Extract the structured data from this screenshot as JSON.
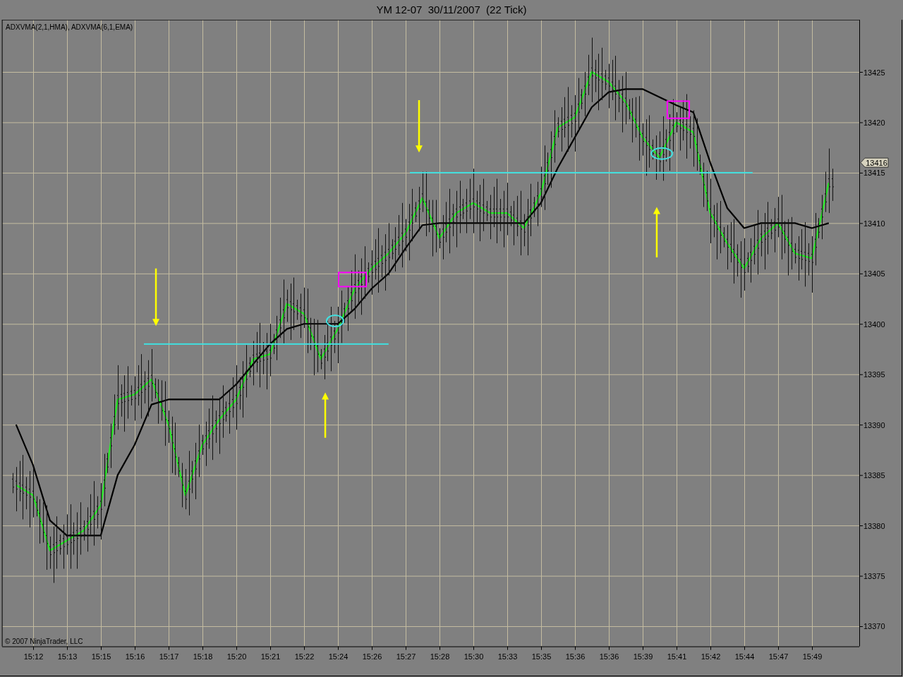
{
  "window": {
    "title": "YM 12-07  30/11/2007  (22 Tick)"
  },
  "chart": {
    "indicator_label": "ADXVMA(2,1,HMA), ADXVMA(6,1,EMA)",
    "copyright": "© 2007 NinjaTrader, LLC",
    "last_price_tag": "13416",
    "chart_data": {
      "type": "line",
      "categories": [
        null,
        "15:12",
        null,
        "15:13",
        null,
        "15:15",
        null,
        "15:16",
        null,
        "15:17",
        null,
        "15:18",
        null,
        "15:20",
        null,
        "15:21",
        null,
        "15:22",
        null,
        "15:24",
        null,
        "15:26",
        null,
        "15:27",
        null,
        "15:28",
        null,
        "15:30",
        null,
        "15:33",
        null,
        "15:35",
        null,
        "15:36",
        null,
        "15:36",
        null,
        "15:39",
        null,
        "15:41",
        null,
        "15:42",
        null,
        "15:44",
        null,
        "15:47",
        null,
        "15:49",
        null
      ],
      "series": [
        {
          "color": "#22e622",
          "values": [
            13384,
            13383,
            13377.5,
            13378.5,
            13379.5,
            13382,
            13392.5,
            13393,
            13394.5,
            13390,
            13383,
            13388,
            13390.5,
            13392.5,
            13396.5,
            13397,
            13402,
            13401,
            13396.5,
            13399.5,
            13403.5,
            13405.5,
            13407,
            13409,
            13412.5,
            13408.5,
            13411,
            13412,
            13411,
            13411,
            13409.5,
            13413,
            13419.5,
            13420.5,
            13425,
            13424,
            13422,
            13418.5,
            13416.5,
            13420,
            13419,
            13411,
            13408,
            13405.5,
            13408.5,
            13410,
            13407,
            13406.5,
            13414
          ]
        },
        {
          "color": "#000000",
          "values": [
            13390,
            13386,
            13380.5,
            13379,
            13379,
            13379,
            13385,
            13388,
            13392,
            13392.5,
            13392.5,
            13392.5,
            13392.5,
            13394,
            13396,
            13398,
            13399.5,
            13400,
            13400,
            13400,
            13401.5,
            13403.5,
            13405,
            13407.5,
            13409.8,
            13410,
            13410,
            13410,
            13410,
            13410,
            13410,
            13412,
            13415.5,
            13418.5,
            13421.5,
            13423,
            13423.3,
            13423.3,
            13422.5,
            13421.7,
            13421,
            13416,
            13411.5,
            13409.5,
            13410,
            13410,
            13410,
            13409.5,
            13410
          ]
        }
      ],
      "grid": true,
      "ylim": [
        13368,
        13430.2
      ],
      "yticks": [
        13370,
        13375,
        13380,
        13385,
        13390,
        13395,
        13400,
        13405,
        13410,
        13415,
        13420,
        13425
      ]
    },
    "markings": [
      {
        "kind": "hline",
        "color": "#40e0e0"
      },
      {
        "kind": "hline",
        "color": "#40e0e0"
      },
      {
        "kind": "arrow",
        "color": "#ffff00"
      },
      {
        "kind": "arrow",
        "color": "#ffff00"
      },
      {
        "kind": "arrow",
        "color": "#ffff00"
      },
      {
        "kind": "arrow",
        "color": "#ffff00"
      },
      {
        "kind": "rect",
        "color": "#ff00ff"
      },
      {
        "kind": "rect",
        "color": "#ff00ff"
      },
      {
        "kind": "ellipse",
        "color": "#40e0e0"
      },
      {
        "kind": "ellipse",
        "color": "#40e0e0"
      }
    ]
  }
}
